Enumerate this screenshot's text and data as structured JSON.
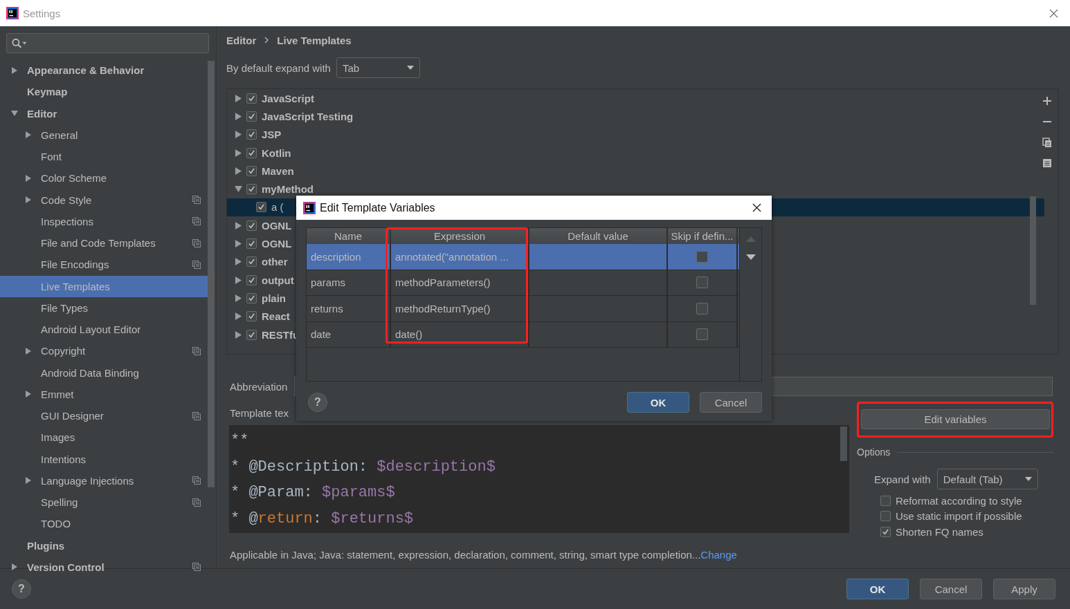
{
  "window": {
    "title": "Settings"
  },
  "sidebar": {
    "items": [
      {
        "label": "Appearance & Behavior",
        "kind": "folder",
        "expanded": false,
        "selected": false,
        "shared": false
      },
      {
        "label": "Keymap",
        "kind": "leaf",
        "selected": false,
        "shared": false
      },
      {
        "label": "Editor",
        "kind": "folder",
        "expanded": true,
        "selected": false,
        "shared": false,
        "children": [
          {
            "label": "General",
            "kind": "folder",
            "expanded": false,
            "selected": false,
            "shared": false
          },
          {
            "label": "Font",
            "kind": "leaf",
            "selected": false,
            "shared": false
          },
          {
            "label": "Color Scheme",
            "kind": "folder",
            "expanded": false,
            "selected": false,
            "shared": false
          },
          {
            "label": "Code Style",
            "kind": "folder",
            "expanded": false,
            "selected": false,
            "shared": true
          },
          {
            "label": "Inspections",
            "kind": "leaf",
            "selected": false,
            "shared": true
          },
          {
            "label": "File and Code Templates",
            "kind": "leaf",
            "selected": false,
            "shared": true
          },
          {
            "label": "File Encodings",
            "kind": "leaf",
            "selected": false,
            "shared": true
          },
          {
            "label": "Live Templates",
            "kind": "leaf",
            "selected": true,
            "shared": false
          },
          {
            "label": "File Types",
            "kind": "leaf",
            "selected": false,
            "shared": false
          },
          {
            "label": "Android Layout Editor",
            "kind": "leaf",
            "selected": false,
            "shared": false
          },
          {
            "label": "Copyright",
            "kind": "folder",
            "expanded": false,
            "selected": false,
            "shared": true
          },
          {
            "label": "Android Data Binding",
            "kind": "leaf",
            "selected": false,
            "shared": false
          },
          {
            "label": "Emmet",
            "kind": "folder",
            "expanded": false,
            "selected": false,
            "shared": false
          },
          {
            "label": "GUI Designer",
            "kind": "leaf",
            "selected": false,
            "shared": true
          },
          {
            "label": "Images",
            "kind": "leaf",
            "selected": false,
            "shared": false
          },
          {
            "label": "Intentions",
            "kind": "leaf",
            "selected": false,
            "shared": false
          },
          {
            "label": "Language Injections",
            "kind": "folder",
            "expanded": false,
            "selected": false,
            "shared": true
          },
          {
            "label": "Spelling",
            "kind": "leaf",
            "selected": false,
            "shared": true
          },
          {
            "label": "TODO",
            "kind": "leaf",
            "selected": false,
            "shared": false
          }
        ]
      },
      {
        "label": "Plugins",
        "kind": "leaf",
        "selected": false,
        "shared": false
      },
      {
        "label": "Version Control",
        "kind": "folder",
        "expanded": false,
        "selected": false,
        "shared": true
      }
    ]
  },
  "breadcrumb": [
    "Editor",
    "Live Templates"
  ],
  "expand_default": {
    "label": "By default expand with",
    "value": "Tab"
  },
  "templates": [
    {
      "label": "JavaScript",
      "expanded": false,
      "checked": true
    },
    {
      "label": "JavaScript Testing",
      "expanded": false,
      "checked": true
    },
    {
      "label": "JSP",
      "expanded": false,
      "checked": true
    },
    {
      "label": "Kotlin",
      "expanded": false,
      "checked": true
    },
    {
      "label": "Maven",
      "expanded": false,
      "checked": true
    },
    {
      "label": "myMethod",
      "expanded": true,
      "checked": true,
      "children": [
        {
          "label": "a (",
          "checked": true,
          "selected": true
        }
      ]
    },
    {
      "label": "OGNL",
      "expanded": false,
      "checked": true
    },
    {
      "label": "OGNL",
      "expanded": false,
      "checked": true
    },
    {
      "label": "other",
      "expanded": false,
      "checked": true
    },
    {
      "label": "output",
      "expanded": false,
      "checked": true
    },
    {
      "label": "plain",
      "expanded": false,
      "checked": true
    },
    {
      "label": "React",
      "expanded": false,
      "checked": true
    },
    {
      "label": "RESTfu",
      "expanded": false,
      "checked": true
    }
  ],
  "abbreviation_label": "Abbreviation",
  "template_text_label": "Template tex",
  "template_text": [
    [
      {
        "kind": "text",
        "text": "**"
      }
    ],
    [
      {
        "kind": "text",
        "text": "* @Description: "
      },
      {
        "kind": "variable",
        "text": "$description$"
      }
    ],
    [
      {
        "kind": "text",
        "text": "* @Param: "
      },
      {
        "kind": "variable",
        "text": "$params$"
      }
    ],
    [
      {
        "kind": "text",
        "text": "* @"
      },
      {
        "kind": "keyword",
        "text": "return"
      },
      {
        "kind": "text",
        "text": ": "
      },
      {
        "kind": "variable",
        "text": "$returns$"
      }
    ]
  ],
  "edit_variables": {
    "label": "Edit variables",
    "highlighted": true
  },
  "options": {
    "title": "Options",
    "expand_label": "Expand with",
    "expand_value": "Default (Tab)",
    "checkboxes": [
      {
        "label": "Reformat according to style",
        "checked": false
      },
      {
        "label": "Use static import if possible",
        "checked": false
      },
      {
        "label": "Shorten FQ names",
        "checked": true
      }
    ]
  },
  "applicable": "Applicable in Java; Java: statement, expression, declaration, comment, string, smart type completion...",
  "change_link": "Change",
  "footer": {
    "help": "?",
    "buttons": [
      {
        "label": "OK",
        "kind": "primary"
      },
      {
        "label": "Cancel",
        "kind": "normal"
      },
      {
        "label": "Apply",
        "kind": "normal"
      }
    ]
  },
  "dialog": {
    "title": "Edit Template Variables",
    "columns": [
      {
        "label": "Name",
        "highlighted": false
      },
      {
        "label": "Expression",
        "highlighted": true
      },
      {
        "label": "Default value",
        "highlighted": false
      },
      {
        "label": "Skip if defin...",
        "highlighted": false
      }
    ],
    "rows": [
      {
        "name": "description",
        "expression": "annotated(\"annotation ...",
        "skip": false,
        "selected": true
      },
      {
        "name": "params",
        "expression": "methodParameters()",
        "skip": false,
        "selected": false
      },
      {
        "name": "returns",
        "expression": "methodReturnType()",
        "skip": false,
        "selected": false
      },
      {
        "name": "date",
        "expression": "date()",
        "skip": false,
        "selected": false
      }
    ],
    "help": "?",
    "buttons": [
      {
        "label": "OK",
        "kind": "primary"
      },
      {
        "label": "Cancel",
        "kind": "normal"
      }
    ]
  }
}
